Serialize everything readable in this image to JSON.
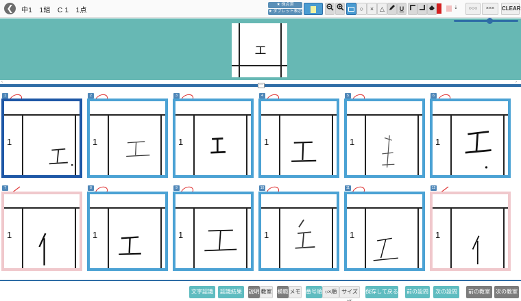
{
  "header": {
    "title": "中1　1組　C 1　1点",
    "badges": [
      "★ 採点済",
      "★ タブレット表示"
    ],
    "mark_tools": [
      "○",
      "×",
      "△"
    ],
    "underline_glyph": "U",
    "stroke_colors": [
      "#d42020",
      "#f3c1c1"
    ],
    "arrow_glyph": "⇣",
    "stamp_labels": [
      "○○○",
      "×××"
    ],
    "clear_label": "CLEAR"
  },
  "preview": {
    "answer_char": "エ"
  },
  "cards": [
    {
      "no": "1",
      "qnum": "1",
      "mark": "circle",
      "style": "selected"
    },
    {
      "no": "2",
      "qnum": "1",
      "mark": "circle",
      "style": "normal"
    },
    {
      "no": "3",
      "qnum": "1",
      "mark": "circle",
      "style": "normal"
    },
    {
      "no": "4",
      "qnum": "1",
      "mark": "circle",
      "style": "normal"
    },
    {
      "no": "5",
      "qnum": "1",
      "mark": "circle",
      "style": "normal"
    },
    {
      "no": "6",
      "qnum": "1",
      "mark": "circle",
      "style": "normal"
    },
    {
      "no": "7",
      "qnum": "1",
      "mark": "slash",
      "style": "pink"
    },
    {
      "no": "8",
      "qnum": "1",
      "mark": "circle",
      "style": "normal"
    },
    {
      "no": "9",
      "qnum": "1",
      "mark": "circle",
      "style": "normal"
    },
    {
      "no": "10",
      "qnum": "1",
      "mark": "circle",
      "style": "normal"
    },
    {
      "no": "11",
      "qnum": "1",
      "mark": "circle",
      "style": "normal"
    },
    {
      "no": "12",
      "qnum": "1",
      "mark": "slash",
      "style": "pink"
    }
  ],
  "footer": {
    "char_recognition": "文字認識",
    "recognition_result": "認識結果",
    "toggle_a": [
      "説明",
      "教室"
    ],
    "toggle_b": [
      "模範",
      "メモ"
    ],
    "toggle_c": [
      "番号順",
      "○×順",
      "サイズ順"
    ],
    "save_back": "保存して戻る",
    "prev_question": "前の設問",
    "next_question": "次の設問",
    "prev_class": "前の教室",
    "next_class": "次の教室"
  }
}
